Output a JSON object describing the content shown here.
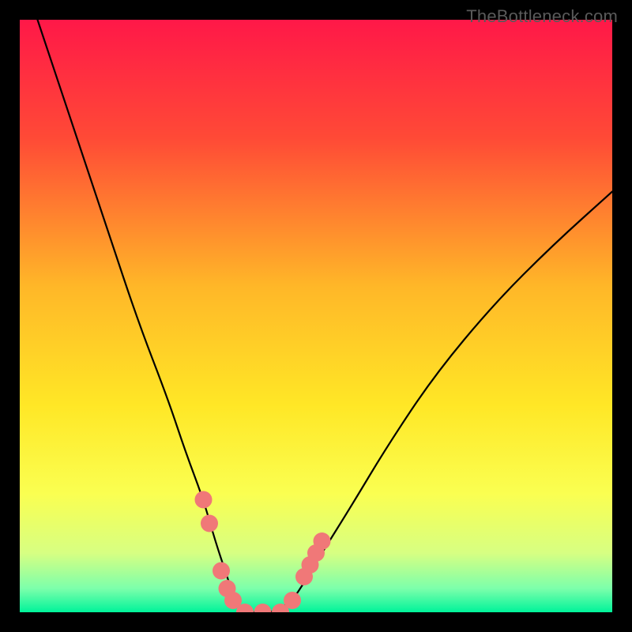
{
  "watermark": "TheBottleneck.com",
  "chart_data": {
    "type": "line",
    "title": "",
    "xlabel": "",
    "ylabel": "",
    "xlim": [
      0,
      100
    ],
    "ylim": [
      0,
      100
    ],
    "background_gradient": {
      "stops": [
        {
          "offset": 0.0,
          "color": "#ff1848"
        },
        {
          "offset": 0.2,
          "color": "#ff4a36"
        },
        {
          "offset": 0.45,
          "color": "#ffb728"
        },
        {
          "offset": 0.65,
          "color": "#ffe726"
        },
        {
          "offset": 0.8,
          "color": "#faff51"
        },
        {
          "offset": 0.9,
          "color": "#d7ff82"
        },
        {
          "offset": 0.96,
          "color": "#7cffab"
        },
        {
          "offset": 1.0,
          "color": "#00f39a"
        }
      ]
    },
    "series": [
      {
        "name": "bottleneck-curve",
        "x": [
          3,
          9,
          15,
          20,
          25,
          28,
          31,
          33,
          35,
          36,
          37,
          38,
          40,
          43,
          46,
          48,
          51,
          56,
          62,
          70,
          80,
          90,
          100
        ],
        "values": [
          100,
          82,
          64,
          49,
          36,
          27,
          19,
          12,
          6,
          3,
          1,
          0,
          0,
          0,
          2,
          5,
          10,
          18,
          28,
          40,
          52,
          62,
          71
        ]
      }
    ],
    "markers": {
      "name": "highlighted-points",
      "color": "#f07878",
      "points": [
        {
          "x": 31,
          "y": 19
        },
        {
          "x": 32,
          "y": 15
        },
        {
          "x": 34,
          "y": 7
        },
        {
          "x": 35,
          "y": 4
        },
        {
          "x": 36,
          "y": 2
        },
        {
          "x": 38,
          "y": 0
        },
        {
          "x": 41,
          "y": 0
        },
        {
          "x": 44,
          "y": 0
        },
        {
          "x": 46,
          "y": 2
        },
        {
          "x": 48,
          "y": 6
        },
        {
          "x": 49,
          "y": 8
        },
        {
          "x": 50,
          "y": 10
        },
        {
          "x": 51,
          "y": 12
        }
      ]
    }
  }
}
